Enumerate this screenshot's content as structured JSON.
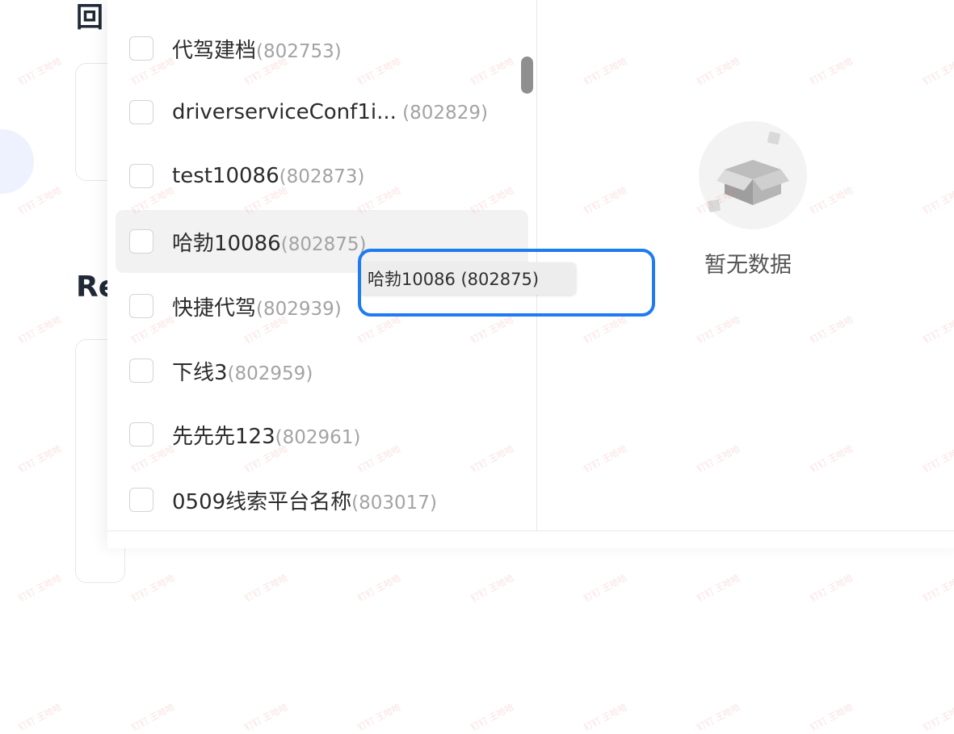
{
  "background": {
    "title_fragment": "回",
    "heading_fragment": "Re"
  },
  "list": {
    "items": [
      {
        "name": "代驾建档",
        "id": "(802753)"
      },
      {
        "name": "driverserviceConf1i...",
        "id": " (802829)"
      },
      {
        "name": "test10086",
        "id": "(802873)"
      },
      {
        "name": "哈勃10086",
        "id": "(802875)"
      },
      {
        "name": "快捷代驾",
        "id": "(802939)"
      },
      {
        "name": "下线3",
        "id": "(802959)"
      },
      {
        "name": "先先先123",
        "id": "(802961)"
      },
      {
        "name": "0509线索平台名称",
        "id": "(803017)"
      }
    ]
  },
  "tooltip": {
    "text": "哈勃10086 (802875)"
  },
  "empty_state": {
    "text": "暂无数据",
    "icon": "empty-box-icon"
  },
  "watermark": {
    "text": "钉钉 王哈哈"
  },
  "colors": {
    "highlight": "#1e7bf2"
  }
}
